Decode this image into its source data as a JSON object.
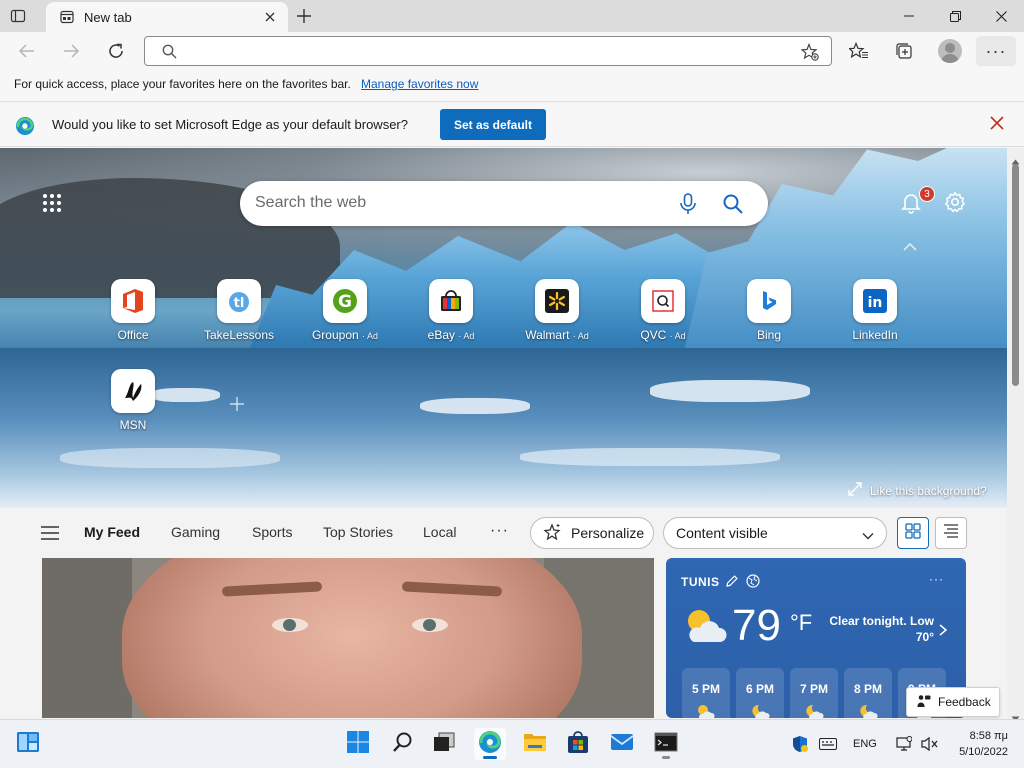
{
  "browser": {
    "tab_title": "New tab",
    "address_placeholder": "",
    "favorites_bar_message": "For quick access, place your favorites here on the favorites bar.",
    "favorites_bar_link": "Manage favorites now"
  },
  "infobar": {
    "message": "Would you like to set Microsoft Edge as your default browser?",
    "button_label": "Set as default"
  },
  "hero": {
    "search_placeholder": "Search the web",
    "notification_count": "3",
    "like_background": "Like this background?"
  },
  "quick_links": [
    {
      "label": "Office",
      "ad": "",
      "icon": "office-icon"
    },
    {
      "label": "TakeLessons",
      "ad": "",
      "icon": "takelessons-icon"
    },
    {
      "label": "Groupon",
      "ad": "· Ad",
      "icon": "groupon-icon"
    },
    {
      "label": "eBay",
      "ad": "· Ad",
      "icon": "ebay-icon"
    },
    {
      "label": "Walmart",
      "ad": "· Ad",
      "icon": "walmart-icon"
    },
    {
      "label": "QVC",
      "ad": "· Ad",
      "icon": "qvc-icon"
    },
    {
      "label": "Bing",
      "ad": "",
      "icon": "bing-icon"
    },
    {
      "label": "LinkedIn",
      "ad": "",
      "icon": "linkedin-icon"
    },
    {
      "label": "MSN",
      "ad": "",
      "icon": "msn-icon"
    }
  ],
  "feed": {
    "tabs": [
      "My Feed",
      "Gaming",
      "Sports",
      "Top Stories",
      "Local"
    ],
    "active_tab": "My Feed",
    "personalize_label": "Personalize",
    "content_select_value": "Content visible"
  },
  "weather": {
    "city": "TUNIS",
    "temperature": "79",
    "unit": "°F",
    "summary": "Clear tonight. Low 70°",
    "hours": [
      "5 PM",
      "6 PM",
      "7 PM",
      "8 PM",
      "9 PM"
    ]
  },
  "feedback_label": "Feedback",
  "taskbar": {
    "language": "ENG",
    "time": "8:58 πμ",
    "date": "5/10/2022"
  },
  "colors": {
    "accent": "#0f6cbd",
    "weather_bg": "#2c5fa8",
    "badge": "#d13b2a"
  }
}
